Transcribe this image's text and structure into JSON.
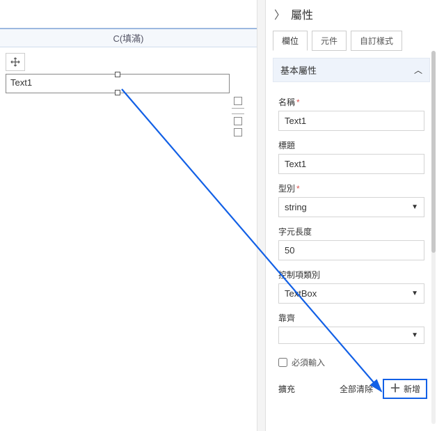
{
  "canvas": {
    "column_header": "C(填滿)",
    "selected_text": "Text1"
  },
  "panel": {
    "title": "屬性",
    "tabs": {
      "field": "欄位",
      "component": "元件",
      "custom_style": "自訂樣式"
    },
    "section_basic": "基本屬性",
    "fields": {
      "name_label": "名稱",
      "name_value": "Text1",
      "title_label": "標題",
      "title_value": "Text1",
      "type_label": "型別",
      "type_value": "string",
      "len_label": "字元長度",
      "len_value": "50",
      "ctrl_label": "控制項類別",
      "ctrl_value": "TextBox",
      "align_label": "靠齊",
      "align_value": "",
      "required_label": "必須輸入"
    },
    "ext": {
      "label": "擴充",
      "clear_all": "全部清除",
      "add": "新增"
    }
  }
}
